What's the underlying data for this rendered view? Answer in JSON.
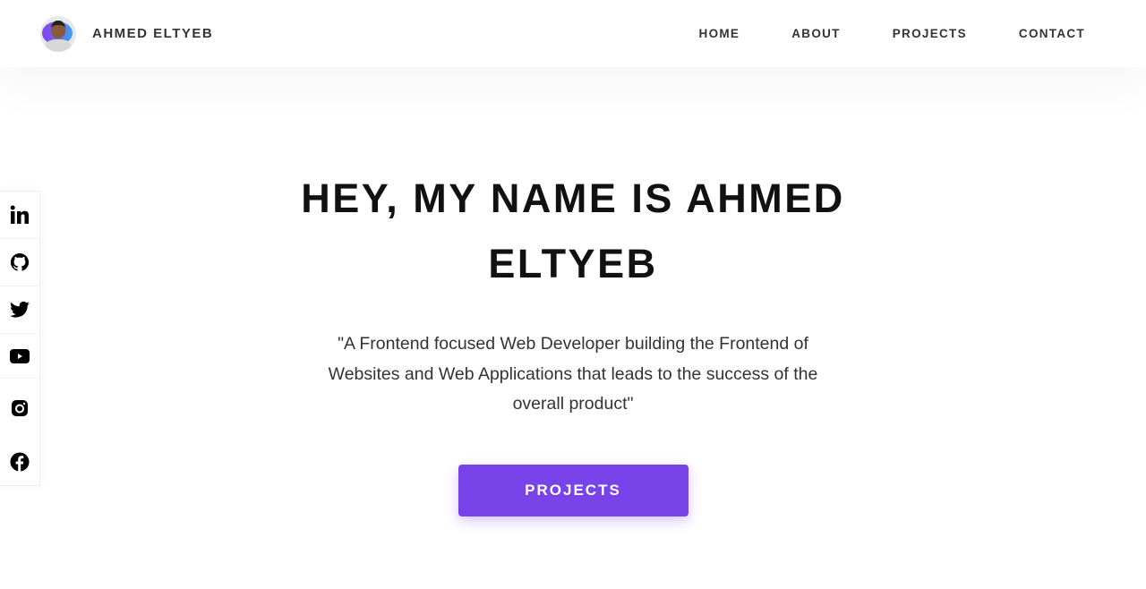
{
  "header": {
    "name": "AHMED ELTYEB",
    "nav": [
      "HOME",
      "ABOUT",
      "PROJECTS",
      "CONTACT"
    ]
  },
  "social": [
    "linkedin-icon",
    "github-icon",
    "twitter-icon",
    "youtube-icon",
    "instagram-icon",
    "facebook-icon"
  ],
  "hero": {
    "title": "HEY, MY NAME IS AHMED ELTYEB",
    "quote": "\"A Frontend focused Web Developer building the Frontend of Websites and Web Applications that leads to the success of the overall product\"",
    "button": "PROJECTS"
  },
  "colors": {
    "accent": "#7843e9"
  }
}
